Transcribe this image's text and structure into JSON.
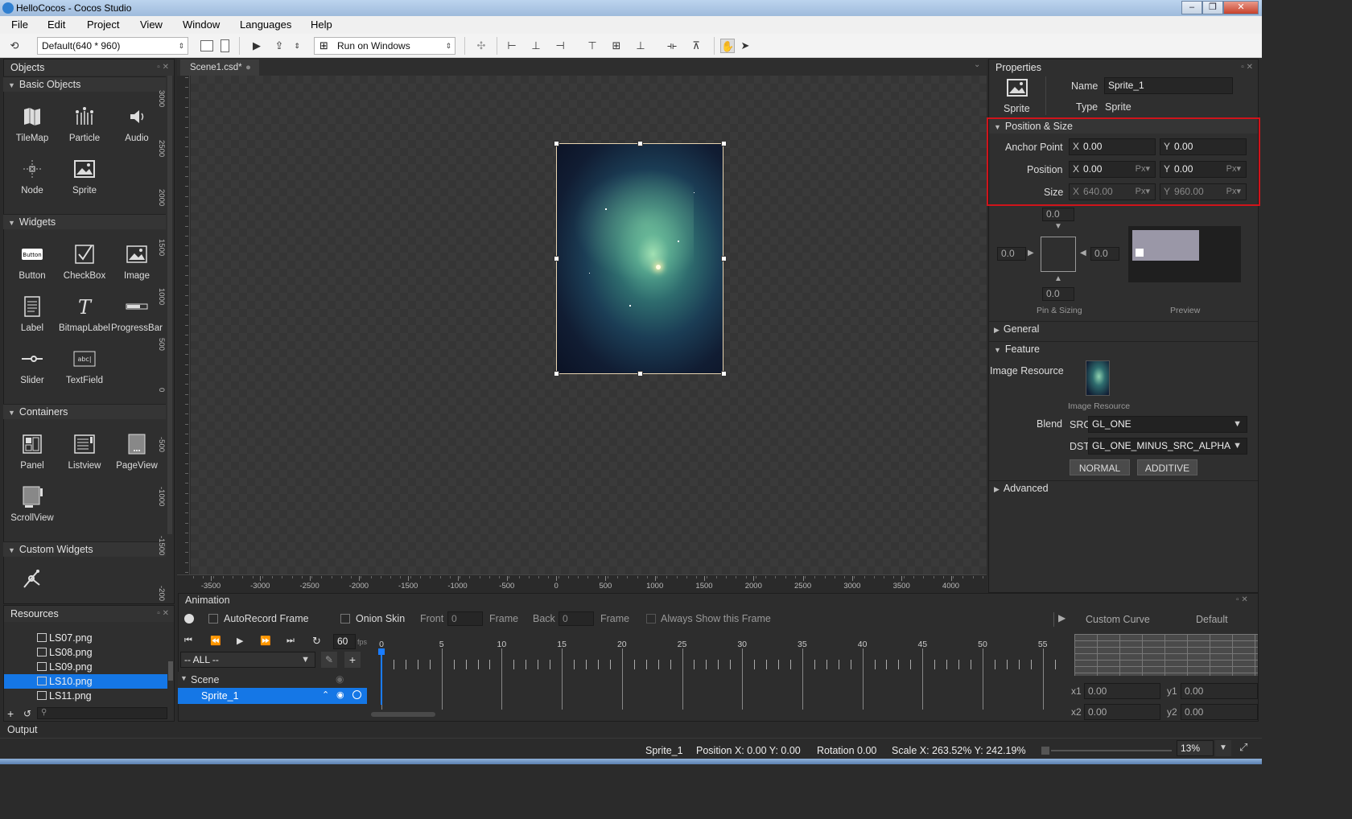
{
  "window": {
    "title": "HelloCocos - Cocos Studio"
  },
  "menu": [
    "File",
    "Edit",
    "Project",
    "View",
    "Window",
    "Languages",
    "Help"
  ],
  "toolbar": {
    "resolution": "Default(640 * 960)",
    "run_target": "Run on Windows"
  },
  "objects_panel": {
    "title": "Objects",
    "sections": {
      "basic": "Basic Objects",
      "widgets": "Widgets",
      "containers": "Containers",
      "custom": "Custom Widgets"
    },
    "basic_items": [
      "TileMap",
      "Particle",
      "Audio",
      "Node",
      "Sprite"
    ],
    "widget_items": [
      "Button",
      "CheckBox",
      "Image",
      "Label",
      "BitmapLabel",
      "ProgressBar",
      "Slider",
      "TextField"
    ],
    "container_items": [
      "Panel",
      "Listview",
      "PageView",
      "ScrollView"
    ]
  },
  "resources_panel": {
    "title": "Resources",
    "files": [
      "LS07.png",
      "LS08.png",
      "LS09.png",
      "LS10.png",
      "LS11.png"
    ],
    "selected": "LS10.png"
  },
  "document_tab": "Scene1.csd*",
  "ruler": {
    "x_labels": [
      "-3500",
      "-3000",
      "-2500",
      "-2000",
      "-1500",
      "-1000",
      "-500",
      "0",
      "500",
      "1000",
      "1500",
      "2000",
      "2500",
      "3000",
      "3500",
      "4000"
    ],
    "y_labels": [
      "3000",
      "2500",
      "2000",
      "1500",
      "1000",
      "500",
      "0",
      "-500",
      "-1000",
      "-1500",
      "-200"
    ]
  },
  "properties": {
    "title": "Properties",
    "node_type_label": "Sprite",
    "name_label": "Name",
    "name_value": "Sprite_1",
    "type_label": "Type",
    "type_value": "Sprite",
    "position_size": {
      "title": "Position & Size",
      "anchor_label": "Anchor Point",
      "anchor_x": "0.00",
      "anchor_y": "0.00",
      "position_label": "Position",
      "pos_x": "0.00",
      "pos_y": "0.00",
      "size_label": "Size",
      "size_x": "640.00",
      "size_y": "960.00",
      "unit": "Px"
    },
    "pin": {
      "top": "0.0",
      "left": "0.0",
      "right": "0.0",
      "bottom": "0.0",
      "caption": "Pin & Sizing",
      "preview_caption": "Preview"
    },
    "general": "General",
    "feature": "Feature",
    "image_resource_label": "Image Resource",
    "image_resource_caption": "Image Resource",
    "blend_label": "Blend",
    "src_label": "SRC",
    "src_value": "GL_ONE",
    "dst_label": "DST",
    "dst_value": "GL_ONE_MINUS_SRC_ALPHA",
    "normal_btn": "NORMAL",
    "additive_btn": "ADDITIVE",
    "advanced": "Advanced"
  },
  "animation": {
    "title": "Animation",
    "autorecord": "AutoRecord Frame",
    "onion": "Onion Skin",
    "front": "Front",
    "front_value": "0",
    "frame1": "Frame",
    "back": "Back",
    "back_value": "0",
    "frame2": "Frame",
    "always_show": "Always Show this Frame",
    "fps": "60",
    "fps_unit": "fps",
    "filter": "-- ALL --",
    "scene": "Scene",
    "node": "Sprite_1",
    "timeline_labels": [
      "0",
      "5",
      "10",
      "15",
      "20",
      "25",
      "30",
      "35",
      "40",
      "45",
      "50",
      "55"
    ],
    "custom_curve": "Custom Curve",
    "curve_default": "Default",
    "x1_label": "x1",
    "x1": "0.00",
    "y1_label": "y1",
    "y1": "0.00",
    "x2_label": "x2",
    "x2": "0.00",
    "y2_label": "y2",
    "y2": "0.00"
  },
  "output": {
    "title": "Output"
  },
  "status": {
    "node": "Sprite_1",
    "position": "Position X: 0.00   Y: 0.00",
    "rotation": "Rotation 0.00",
    "scale": "Scale X: 263.52%   Y: 242.19%",
    "zoom": "13%"
  }
}
